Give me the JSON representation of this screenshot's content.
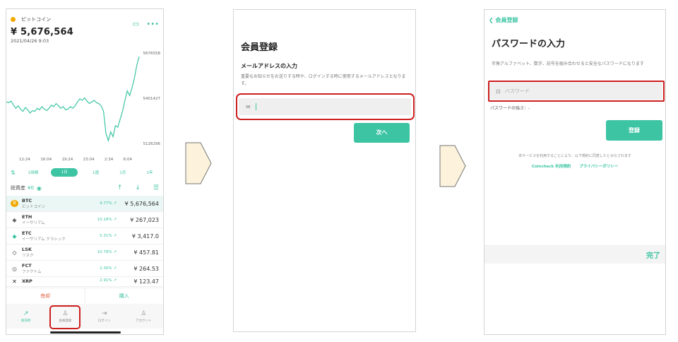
{
  "screen1": {
    "coin_name": "ビットコイン",
    "price": "¥ 5,676,564",
    "date": "2021/04/26 9:03",
    "chart_y_labels": [
      "5676558",
      "5401427",
      "5126296"
    ],
    "chart_x_labels": [
      "12:24",
      "16:04",
      "19:24",
      "23:04",
      "2:34",
      "6:04"
    ],
    "periods": [
      "1時間",
      "1日",
      "1週",
      "1月",
      "1年"
    ],
    "active_period": "1日",
    "assets_label": "総資産",
    "assets_value": "¥0",
    "coins": [
      {
        "sym": "BTC",
        "jp": "ビットコイン",
        "change": "4.77% ↗",
        "price": "¥ 5,676,564",
        "icon": "B"
      },
      {
        "sym": "ETH",
        "jp": "イーサリアム",
        "change": "10.18% ↗",
        "price": "¥ 267,023",
        "icon": "◆"
      },
      {
        "sym": "ETC",
        "jp": "イーサリアム クラシック",
        "change": "5.31% ↗",
        "price": "¥ 3,417.0",
        "icon": "◆"
      },
      {
        "sym": "LSK",
        "jp": "リスク",
        "change": "10.78% ↗",
        "price": "¥ 457.81",
        "icon": "◇"
      },
      {
        "sym": "FCT",
        "jp": "ファクトム",
        "change": "2.30% ↗",
        "price": "¥ 264.53",
        "icon": "◎"
      },
      {
        "sym": "XRP",
        "jp": "",
        "change": "2.91% ↗",
        "price": "¥ 123.47",
        "icon": "✕"
      }
    ],
    "sell_label": "売却",
    "buy_label": "購入",
    "tabs": [
      "販売所",
      "会員登録",
      "ログイン",
      "アカウント"
    ]
  },
  "screen2": {
    "title": "会員登録",
    "subtitle": "メールアドレスの入力",
    "description": "重要なお知らせをお送りする時や、ログインする時に使用するメールアドレスとなります。",
    "email_value": "",
    "next_label": "次へ"
  },
  "screen3": {
    "back_label": "会員登録",
    "title": "パスワードの入力",
    "description": "半角アルファベット、数字、記号を組み合わせると安全なパスワードになります",
    "password_placeholder": "パスワード",
    "strength_label": "パスワードの強さ：-",
    "register_label": "登録",
    "agree_text": "本サービスを利用することにより、以下規約に同意したとみなされます",
    "link_terms": "Coincheck 利用規約",
    "link_privacy": "プライバシーポリシー",
    "done_label": "完了"
  },
  "chart_data": {
    "type": "line",
    "title": "",
    "xlabel": "",
    "ylabel": "",
    "x_tick_labels": [
      "12:24",
      "16:04",
      "19:24",
      "23:04",
      "2:34",
      "6:04"
    ],
    "y_tick_labels": [
      "5676558",
      "5401427",
      "5126296"
    ],
    "ylim": [
      5100000,
      5700000
    ],
    "series": [
      {
        "values": [
          5390000,
          5385000,
          5395000,
          5370000,
          5350000,
          5365000,
          5345000,
          5330000,
          5355000,
          5340000,
          5320000,
          5335000,
          5330000,
          5350000,
          5340000,
          5360000,
          5345000,
          5335000,
          5350000,
          5370000,
          5360000,
          5380000,
          5365000,
          5350000,
          5360000,
          5340000,
          5345000,
          5360000,
          5350000,
          5365000,
          5390000,
          5410000,
          5400000,
          5415000,
          5395000,
          5380000,
          5390000,
          5400000,
          5385000,
          5380000,
          5365000,
          5330000,
          5190000,
          5145000,
          5200000,
          5170000,
          5240000,
          5230000,
          5280000,
          5330000,
          5400000,
          5460000,
          5430000,
          5480000,
          5540000,
          5620000,
          5676558
        ]
      }
    ]
  },
  "colors": {
    "accent": "#3cc4a3",
    "sell": "#e05a3c",
    "highlight": "#cc1f1f",
    "arrow_fill": "#fdf3dc"
  },
  "icons": {
    "chat": "chat-icon",
    "more": "more-icon",
    "eye": "eye-icon",
    "up": "arrow-up-icon",
    "down": "arrow-down-icon",
    "list": "list-icon",
    "mail": "mail-icon",
    "lock": "lock-icon",
    "back": "chevron-left-icon"
  }
}
